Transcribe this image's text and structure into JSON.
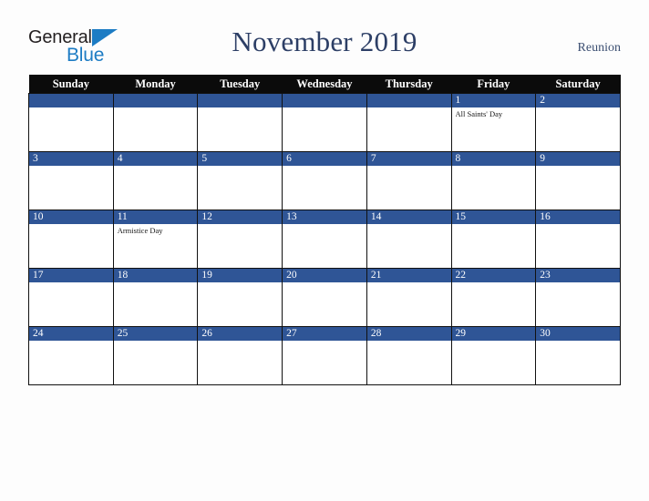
{
  "logo": {
    "word_dark": "General",
    "word_blue": "Blue",
    "triangle_icon": "triangle-icon",
    "colors": {
      "dark": "#231f20",
      "blue": "#1d7cc4"
    }
  },
  "header": {
    "title": "November 2019",
    "region": "Reunion",
    "title_color": "#2d3f66",
    "region_color": "#3c4f72"
  },
  "theme": {
    "page_background": "#fdfdfd",
    "weekday_header_background": "#0b0b0b",
    "weekday_header_text": "#ffffff",
    "date_band": "#2f5596",
    "date_text": "#ffffff",
    "cell_background": "#ffffff",
    "grid_line": "#111111"
  },
  "calendar": {
    "month": "November",
    "year": "2019",
    "weekdays": [
      "Sunday",
      "Monday",
      "Tuesday",
      "Wednesday",
      "Thursday",
      "Friday",
      "Saturday"
    ],
    "weeks": [
      [
        {
          "date": "",
          "events": []
        },
        {
          "date": "",
          "events": []
        },
        {
          "date": "",
          "events": []
        },
        {
          "date": "",
          "events": []
        },
        {
          "date": "",
          "events": []
        },
        {
          "date": "1",
          "events": [
            "All Saints' Day"
          ]
        },
        {
          "date": "2",
          "events": []
        }
      ],
      [
        {
          "date": "3",
          "events": []
        },
        {
          "date": "4",
          "events": []
        },
        {
          "date": "5",
          "events": []
        },
        {
          "date": "6",
          "events": []
        },
        {
          "date": "7",
          "events": []
        },
        {
          "date": "8",
          "events": []
        },
        {
          "date": "9",
          "events": []
        }
      ],
      [
        {
          "date": "10",
          "events": []
        },
        {
          "date": "11",
          "events": [
            "Armistice Day"
          ]
        },
        {
          "date": "12",
          "events": []
        },
        {
          "date": "13",
          "events": []
        },
        {
          "date": "14",
          "events": []
        },
        {
          "date": "15",
          "events": []
        },
        {
          "date": "16",
          "events": []
        }
      ],
      [
        {
          "date": "17",
          "events": []
        },
        {
          "date": "18",
          "events": []
        },
        {
          "date": "19",
          "events": []
        },
        {
          "date": "20",
          "events": []
        },
        {
          "date": "21",
          "events": []
        },
        {
          "date": "22",
          "events": []
        },
        {
          "date": "23",
          "events": []
        }
      ],
      [
        {
          "date": "24",
          "events": []
        },
        {
          "date": "25",
          "events": []
        },
        {
          "date": "26",
          "events": []
        },
        {
          "date": "27",
          "events": []
        },
        {
          "date": "28",
          "events": []
        },
        {
          "date": "29",
          "events": []
        },
        {
          "date": "30",
          "events": []
        }
      ]
    ]
  }
}
